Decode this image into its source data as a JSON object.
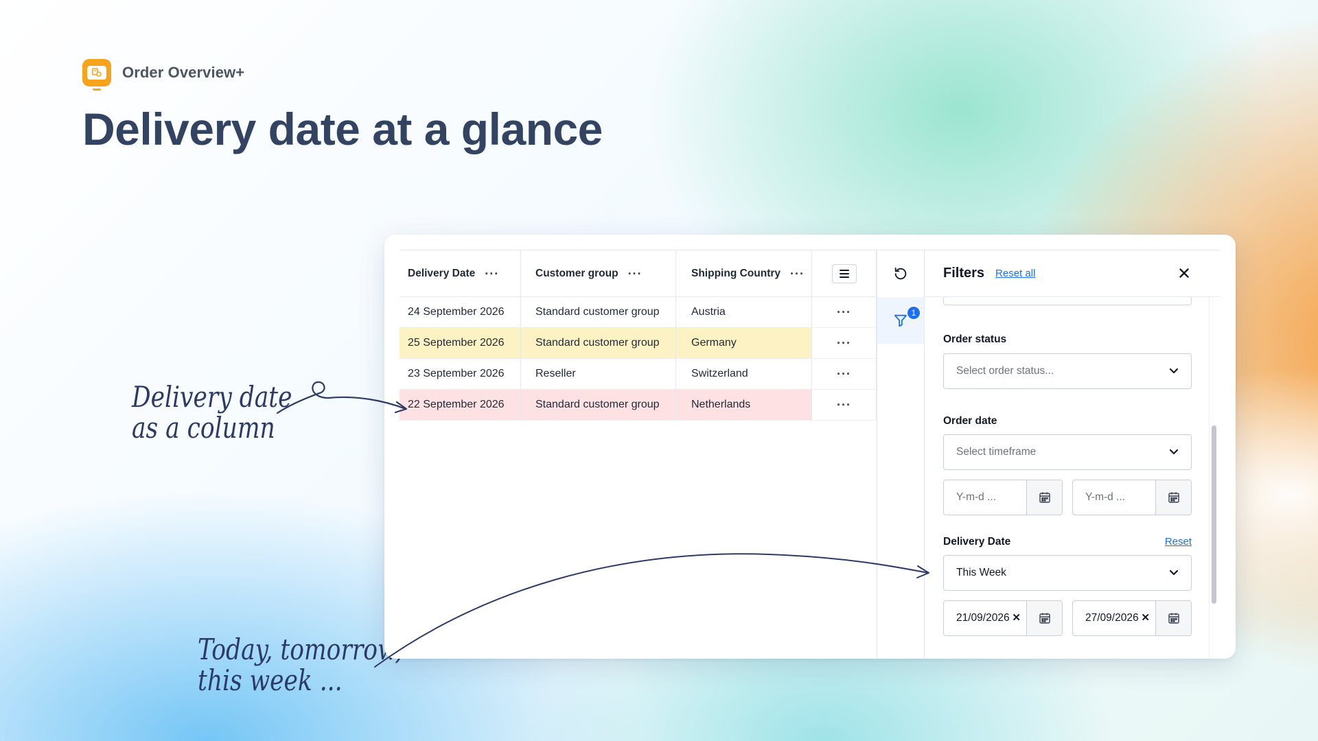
{
  "brand": {
    "name": "Order Overview+"
  },
  "hero": {
    "title": "Delivery date at a glance"
  },
  "annotations": {
    "column_line1": "Delivery date",
    "column_line2": "as a column",
    "range_line1": "Today, tomorrow,",
    "range_line2": "this week ..."
  },
  "table": {
    "columns": [
      "Delivery Date",
      "Customer group",
      "Shipping Country"
    ],
    "rows": [
      {
        "date": "24 September 2026",
        "group": "Standard customer group",
        "country": "Austria",
        "highlight": "none"
      },
      {
        "date": "25 September 2026",
        "group": "Standard customer group",
        "country": "Germany",
        "highlight": "yellow"
      },
      {
        "date": "23 September 2026",
        "group": "Reseller",
        "country": "Switzerland",
        "highlight": "none"
      },
      {
        "date": "22 September 2026",
        "group": "Standard customer group",
        "country": "Netherlands",
        "highlight": "red"
      }
    ]
  },
  "toolbar": {
    "filter_count": "1"
  },
  "filters": {
    "title": "Filters",
    "reset_all": "Reset all",
    "order_status": {
      "label": "Order status",
      "placeholder": "Select order status..."
    },
    "order_date": {
      "label": "Order date",
      "placeholder": "Select timeframe",
      "from_placeholder": "Y-m-d ...",
      "to_placeholder": "Y-m-d ..."
    },
    "delivery_date": {
      "label": "Delivery Date",
      "reset": "Reset",
      "value": "This Week",
      "from": "21/09/2026",
      "to": "27/09/2026"
    }
  },
  "colors": {
    "accent": "#1d6ff2",
    "brand": "#f7a31c",
    "row_yellow": "#fdf2c4",
    "row_red": "#fde1e3",
    "title": "#334463"
  }
}
